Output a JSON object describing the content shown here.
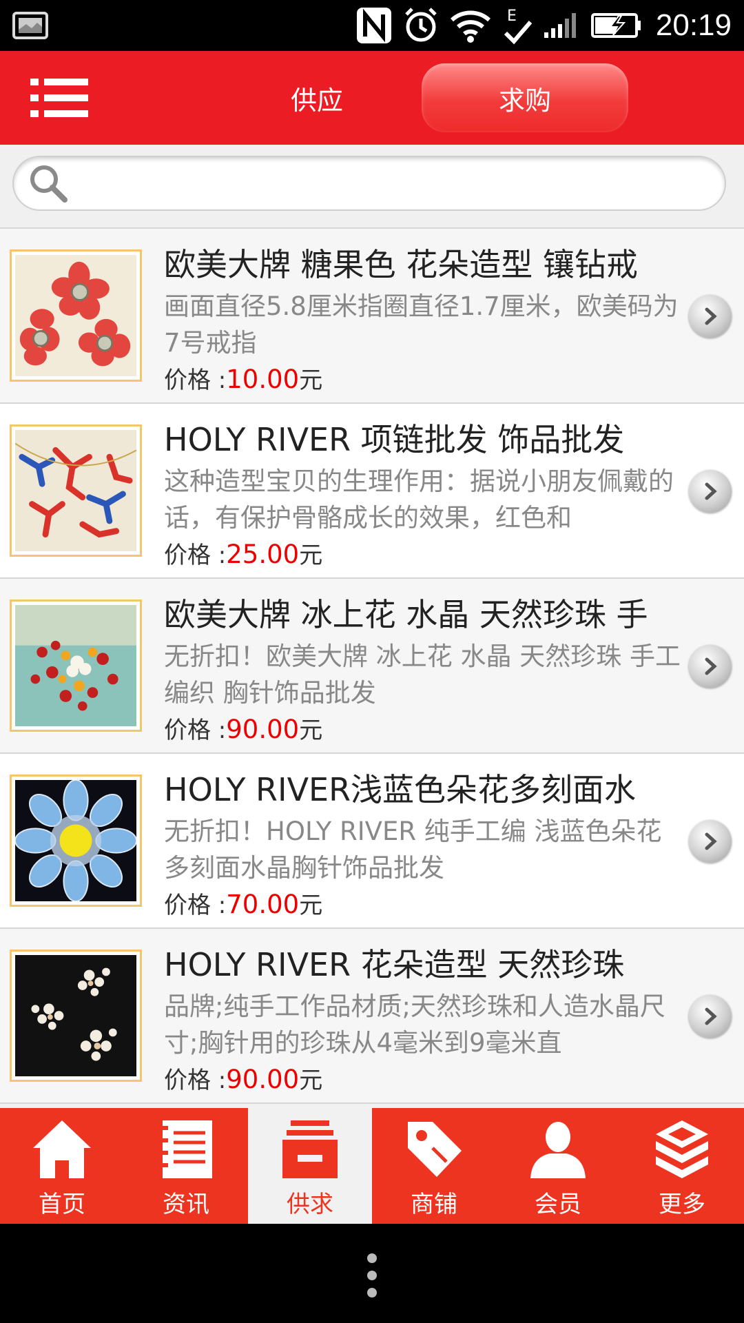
{
  "status_bar": {
    "time": "20:19"
  },
  "header": {
    "tabs": [
      {
        "label": "供应",
        "active": false
      },
      {
        "label": "求购",
        "active": true
      }
    ],
    "accent_color": "#ec1c24"
  },
  "search": {
    "placeholder": "",
    "value": ""
  },
  "products": [
    {
      "title": "欧美大牌 糖果色 花朵造型 镶钻戒",
      "desc": "画面直径5.8厘米指圈直径1.7厘米，欧美码为7号戒指",
      "price_label": "价格 :",
      "price": "10.00",
      "unit": "元"
    },
    {
      "title": "HOLY RIVER 项链批发 饰品批发",
      "desc": "这种造型宝贝的生理作用：据说小朋友佩戴的话，有保护骨骼成长的效果，红色和",
      "price_label": "价格 :",
      "price": "25.00",
      "unit": "元"
    },
    {
      "title": "欧美大牌 冰上花 水晶 天然珍珠 手",
      "desc": "无折扣！欧美大牌 冰上花 水晶 天然珍珠 手工编织 胸针饰品批发",
      "price_label": "价格 :",
      "price": "90.00",
      "unit": "元"
    },
    {
      "title": "HOLY RIVER浅蓝色朵花多刻面水",
      "desc": "无折扣！HOLY RIVER 纯手工编 浅蓝色朵花多刻面水晶胸针饰品批发",
      "price_label": "价格 :",
      "price": "70.00",
      "unit": "元"
    },
    {
      "title": "HOLY RIVER 花朵造型 天然珍珠",
      "desc": "品牌;纯手工作品材质;天然珍珠和人造水晶尺寸;胸针用的珍珠从4毫米到9毫米直",
      "price_label": "价格 :",
      "price": "90.00",
      "unit": "元"
    }
  ],
  "bottom_nav": [
    {
      "label": "首页",
      "icon": "home-icon",
      "active": false
    },
    {
      "label": "资讯",
      "icon": "news-icon",
      "active": false
    },
    {
      "label": "供求",
      "icon": "supply-demand-icon",
      "active": true
    },
    {
      "label": "商铺",
      "icon": "shop-tag-icon",
      "active": false
    },
    {
      "label": "会员",
      "icon": "member-icon",
      "active": false
    },
    {
      "label": "更多",
      "icon": "more-boxes-icon",
      "active": false
    }
  ],
  "colors": {
    "price": "#ee0000",
    "tabbar": "#ed3420"
  }
}
